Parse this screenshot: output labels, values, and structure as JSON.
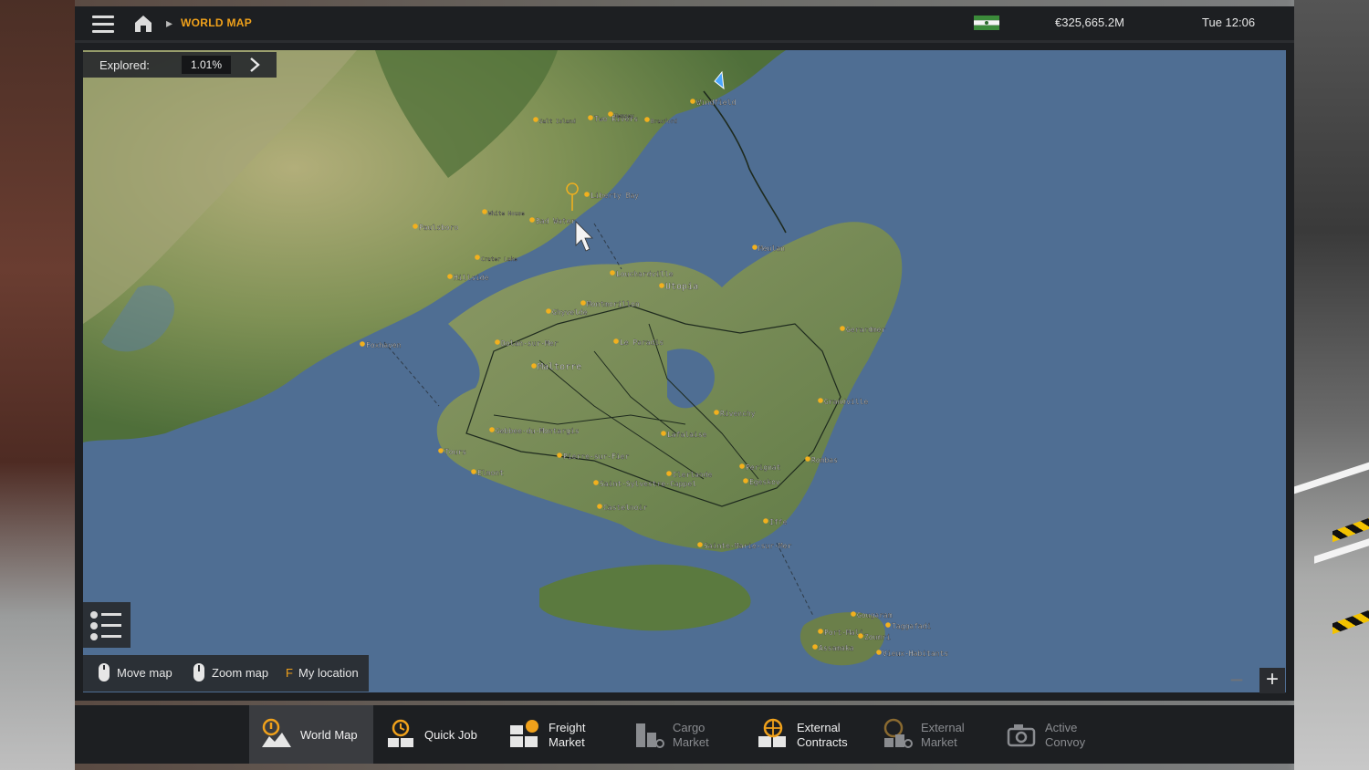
{
  "topbar": {
    "breadcrumb": "WORLD MAP",
    "money": "€325,665.2M",
    "clock": "Tue 12:06"
  },
  "explored": {
    "label": "Explored:",
    "value": "1.01%"
  },
  "map": {
    "cities": [
      "Windfield",
      "Two Rivers",
      "Liberty Bay",
      "Bad Water",
      "Paulsboro",
      "Hillside",
      "Foxhaven",
      "Meulan",
      "Utopia",
      "Louchardville",
      "Ghyvelde",
      "Montmorillon",
      "Le Paradis",
      "Dolan-sur-Mer",
      "Maltorre",
      "Gerardmer",
      "Grandville",
      "Rivenchy",
      "Lafalaise",
      "Tours",
      "Elmont",
      "Gebbee-du-Montargis",
      "Pierre-sur-Fier",
      "Perignat",
      "Rombas",
      "Clerlande",
      "Saint-Sylvestre-Cappel",
      "Egeskov",
      "Castelnoir",
      "Iffe",
      "Sainte-Marie-sur-Mer",
      "Port-Mali",
      "Vieux-Habitants",
      "Gougaram",
      "Taggafadi",
      "Assamaka",
      "Zoumri",
      "Hemsey",
      "Brasford",
      "White House",
      "Crater Lake",
      "Salt Island"
    ]
  },
  "controls": {
    "move": "Move map",
    "zoom": "Zoom map",
    "key": "F",
    "location": "My location"
  },
  "zoom": {
    "out": "−",
    "in": "+"
  },
  "tabs": [
    {
      "line1": "World Map",
      "line2": "",
      "icon": "world-map-icon",
      "active": true
    },
    {
      "line1": "Quick Job",
      "line2": "",
      "icon": "quick-job-icon"
    },
    {
      "line1": "Freight",
      "line2": "Market",
      "icon": "freight-market-icon"
    },
    {
      "line1": "Cargo",
      "line2": "Market",
      "icon": "cargo-market-icon",
      "dim": true
    },
    {
      "line1": "External",
      "line2": "Contracts",
      "icon": "external-contracts-icon"
    },
    {
      "line1": "External",
      "line2": "Market",
      "icon": "external-market-icon",
      "dim": true
    },
    {
      "line1": "Active",
      "line2": "Convoy",
      "icon": "active-convoy-icon",
      "dim": true
    }
  ],
  "colors": {
    "accent": "#f0a11b",
    "sea": "#4f6e93",
    "land": "#7d8f5e",
    "bar": "#1d1f22"
  }
}
